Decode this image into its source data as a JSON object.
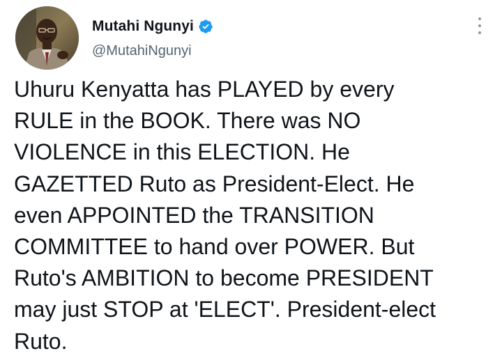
{
  "author": {
    "display_name": "Mutahi Ngunyi",
    "handle": "@MutahiNgunyi",
    "verified": true,
    "verified_color": "#1d9bf0"
  },
  "icons": {
    "avatar": "avatar-photo",
    "verified": "verified-badge-icon",
    "more": "more-options-icon"
  },
  "tweet": {
    "text": "Uhuru Kenyatta has PLAYED by every\nRULE in the BOOK. There was NO\nVIOLENCE in this ELECTION. He\nGAZETTED Ruto as President-Elect. He\neven APPOINTED the TRANSITION\nCOMMITTEE to hand over POWER. But\nRuto's AMBITION to become PRESIDENT\nmay just STOP at 'ELECT'. President-elect\nRuto."
  }
}
